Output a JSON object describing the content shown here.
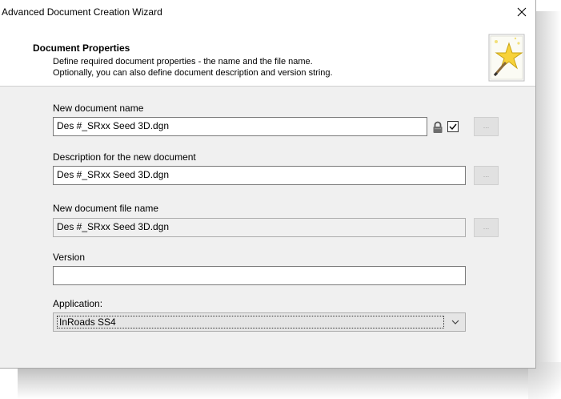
{
  "window": {
    "title": "Advanced Document Creation Wizard",
    "close_glyph": "✕"
  },
  "header": {
    "title": "Document Properties",
    "description_line1": "Define required document properties - the name and the file name.",
    "description_line2": "Optionally, you can also define document description and version string.",
    "icon": "wizard-wand-star-icon"
  },
  "fields": {
    "name": {
      "label": "New document name",
      "value": "Des #_SRxx Seed 3D.dgn",
      "locked": true,
      "checked": true,
      "browse_label": "..."
    },
    "description": {
      "label": "Description for the new document",
      "value": "Des #_SRxx Seed 3D.dgn",
      "browse_label": "..."
    },
    "file_name": {
      "label": "New document file name",
      "value": "Des #_SRxx Seed 3D.dgn",
      "browse_label": "..."
    },
    "version": {
      "label": "Version",
      "value": ""
    },
    "application": {
      "label": "Application:",
      "value": "InRoads SS4"
    }
  },
  "colors": {
    "dialog_bg": "#f0f0f0",
    "header_bg": "#ffffff",
    "disabled_button": "#e1e1e1"
  }
}
